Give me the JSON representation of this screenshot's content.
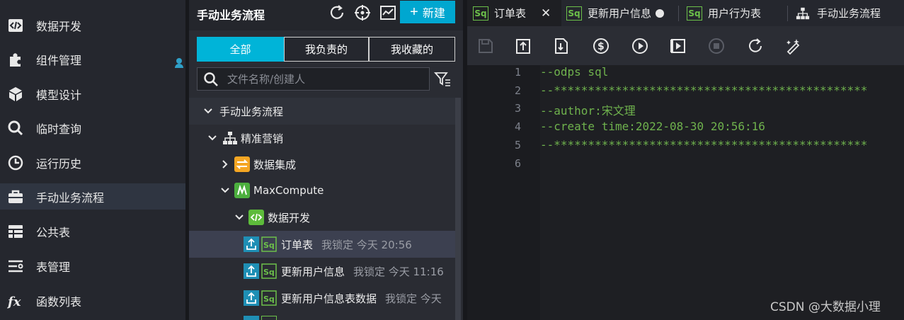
{
  "nav": {
    "items": [
      {
        "label": "数据开发",
        "icon": "code-icon"
      },
      {
        "label": "组件管理",
        "icon": "puzzle-icon"
      },
      {
        "label": "模型设计",
        "icon": "cube-icon"
      },
      {
        "label": "临时查询",
        "icon": "search-icon"
      },
      {
        "label": "运行历史",
        "icon": "clock-icon"
      },
      {
        "label": "手动业务流程",
        "icon": "briefcase-icon"
      },
      {
        "label": "公共表",
        "icon": "table-icon"
      },
      {
        "label": "表管理",
        "icon": "list-icon"
      },
      {
        "label": "函数列表",
        "icon": "fx-icon"
      }
    ],
    "active_index": 5
  },
  "tree_panel": {
    "title": "手动业务流程",
    "new_button": "新建",
    "segments": [
      "全部",
      "我负责的",
      "我收藏的"
    ],
    "active_segment": 0,
    "search_placeholder": "文件名称/创建人",
    "rows": [
      {
        "label": "手动业务流程",
        "meta": ""
      },
      {
        "label": "精准营销",
        "meta": ""
      },
      {
        "label": "数据集成",
        "meta": ""
      },
      {
        "label": "MaxCompute",
        "meta": ""
      },
      {
        "label": "数据开发",
        "meta": ""
      },
      {
        "label": "订单表",
        "meta": "我锁定   今天 20:56"
      },
      {
        "label": "更新用户信息",
        "meta": "我锁定   今天 11:16"
      },
      {
        "label": "更新用户信息表数据",
        "meta": "我锁定   今天"
      }
    ]
  },
  "editor": {
    "tabs": [
      {
        "badge": "Sq",
        "label": "订单表"
      },
      {
        "badge": "Sq",
        "label": "更新用户信息"
      },
      {
        "badge": "Sq",
        "label": "用户行为表"
      },
      {
        "badge": "",
        "label": "手动业务流程"
      }
    ],
    "line_numbers": [
      "1",
      "2",
      "3",
      "4",
      "5",
      "6"
    ],
    "code_lines": [
      "--odps sql",
      "--**********************************************",
      "--author:宋文理",
      "--create time:2022-08-30 20:56:16",
      "--**********************************************",
      ""
    ],
    "accent_color": "#00a7d0",
    "code_color": "#6fb24d"
  },
  "watermark": "CSDN @大数据小理"
}
